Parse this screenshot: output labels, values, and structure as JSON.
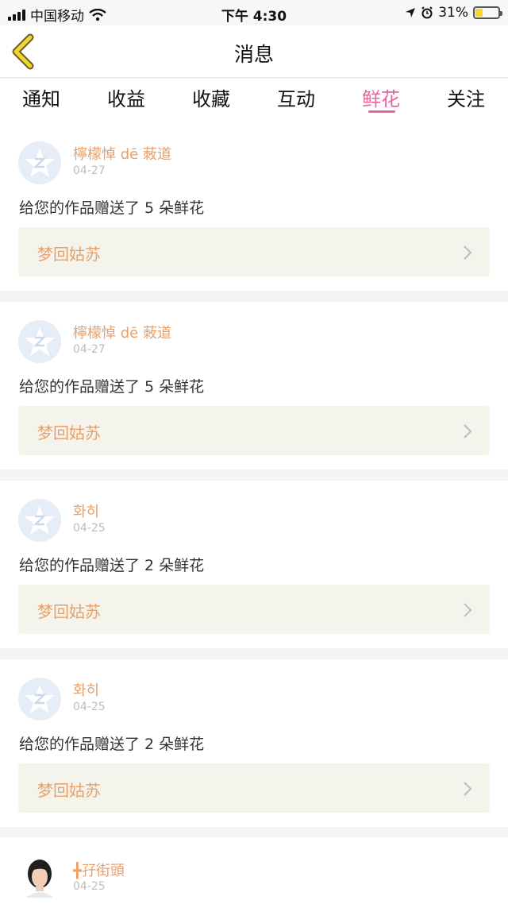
{
  "status_bar": {
    "carrier": "中国移动",
    "time": "下午 4:30",
    "battery": "31%",
    "battery_level": 0.31
  },
  "header": {
    "title": "消息"
  },
  "tabs": [
    {
      "label": "通知",
      "active": false
    },
    {
      "label": "收益",
      "active": false
    },
    {
      "label": "收藏",
      "active": false
    },
    {
      "label": "互动",
      "active": false
    },
    {
      "label": "鲜花",
      "active": true
    },
    {
      "label": "关注",
      "active": false
    }
  ],
  "messages": [
    {
      "user": "檸檬悼 dē 蓛道",
      "date": "04-27",
      "text": "给您的作品赠送了 5 朵鲜花",
      "work": "梦回姑苏"
    },
    {
      "user": "檸檬悼 dē 蓛道",
      "date": "04-27",
      "text": "给您的作品赠送了 5 朵鲜花",
      "work": "梦回姑苏"
    },
    {
      "user": "화히",
      "date": "04-25",
      "text": "给您的作品赠送了 2 朵鲜花",
      "work": "梦回姑苏"
    },
    {
      "user": "화히",
      "date": "04-25",
      "text": "给您的作品赠送了 2 朵鲜花",
      "work": "梦回姑苏"
    },
    {
      "user": "╋孖街頭",
      "date": "04-25"
    }
  ],
  "colors": {
    "accent": "#e4669c",
    "username": "#e8a06a",
    "back_arrow": "#e6cf2f"
  }
}
